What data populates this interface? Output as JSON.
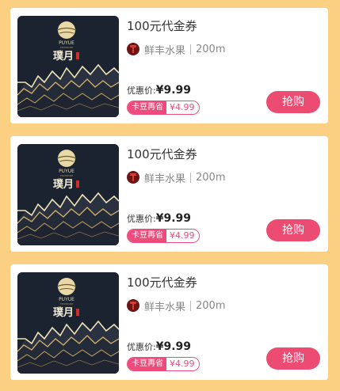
{
  "deals": [
    {
      "title": "100元代金券",
      "shop_name": "鲜丰水果",
      "distance": "200m",
      "price_label": "优惠价:",
      "price": "¥9.99",
      "badge_label": "卡豆再省",
      "badge_value": "¥4.99",
      "button_label": "抢购",
      "logo_en": "PUYUE",
      "logo_cn": "璞月",
      "logo_sub": "TEAHOUSE"
    },
    {
      "title": "100元代金券",
      "shop_name": "鲜丰水果",
      "distance": "200m",
      "price_label": "优惠价:",
      "price": "¥9.99",
      "badge_label": "卡豆再省",
      "badge_value": "¥4.99",
      "button_label": "抢购",
      "logo_en": "PUYUE",
      "logo_cn": "璞月",
      "logo_sub": "TEAHOUSE"
    },
    {
      "title": "100元代金券",
      "shop_name": "鲜丰水果",
      "distance": "200m",
      "price_label": "优惠价:",
      "price": "¥9.99",
      "badge_label": "卡豆再省",
      "badge_value": "¥4.99",
      "button_label": "抢购",
      "logo_en": "PUYUE",
      "logo_cn": "璞月",
      "logo_sub": "TEAHOUSE"
    }
  ],
  "colors": {
    "page_background": "#fcd082",
    "accent_pink": "#ed4c72",
    "thumb_background": "#1b2331",
    "gold": "#d8b36a"
  },
  "icons": {
    "shop_avatar": "shop-logo-icon"
  }
}
